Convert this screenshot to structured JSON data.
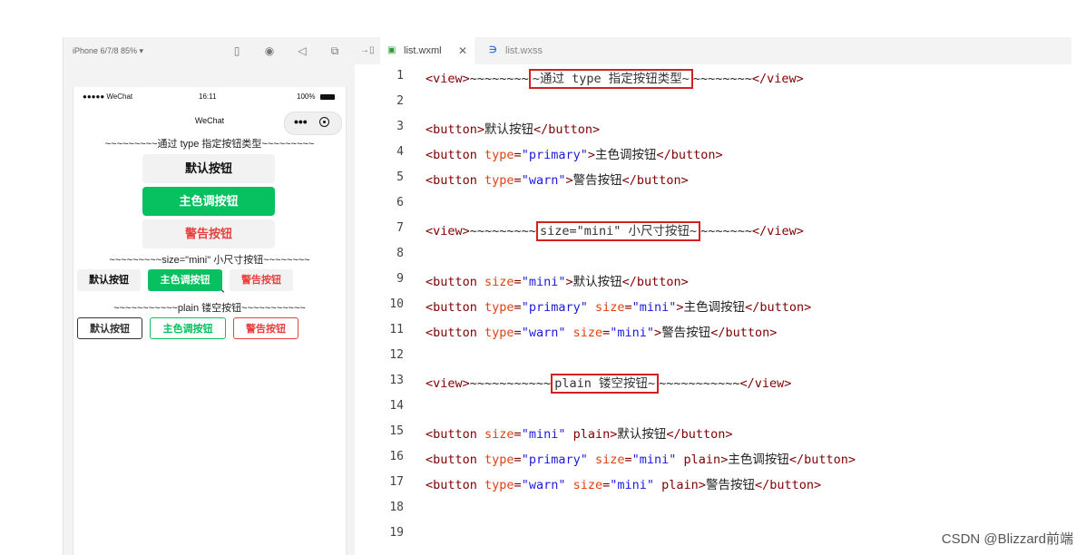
{
  "simulator": {
    "device": "iPhone 6/7/8 85% ▾",
    "statusbar": {
      "carrier": "●●●●● WeChat",
      "time": "16:11",
      "battery": "100%"
    },
    "navbar": {
      "title": "WeChat",
      "more": "•••"
    },
    "sections": [
      "~~~~~~~~~通过 type 指定按钮类型~~~~~~~~~",
      "~~~~~~~~~size=\"mini\" 小尺寸按钮~~~~~~~~",
      "~~~~~~~~~~~plain 镂空按钮~~~~~~~~~~~"
    ],
    "buttons": {
      "default": "默认按钮",
      "primary": "主色调按钮",
      "warn": "警告按钮"
    }
  },
  "editor": {
    "tabs": [
      {
        "name": "list.wxml",
        "close": "✕"
      },
      {
        "name": "list.wxss"
      }
    ],
    "lines": [
      {
        "n": "1",
        "parts": [
          [
            "tg",
            "<view>"
          ],
          [
            "tx",
            "~~~~~~~~"
          ],
          [
            "hl",
            "~通过 type 指定按钮类型~"
          ],
          [
            "tx",
            "~~~~~~~~"
          ],
          [
            "tg",
            "</view>"
          ]
        ]
      },
      {
        "n": "2",
        "parts": []
      },
      {
        "n": "3",
        "parts": [
          [
            "tg",
            "<button>"
          ],
          [
            "tx",
            "默认按钮"
          ],
          [
            "tg",
            "</button>"
          ]
        ]
      },
      {
        "n": "4",
        "parts": [
          [
            "tg",
            "<button "
          ],
          [
            "at",
            "type"
          ],
          [
            "tg",
            "="
          ],
          [
            "st",
            "\"primary\""
          ],
          [
            "tg",
            ">"
          ],
          [
            "tx",
            "主色调按钮"
          ],
          [
            "tg",
            "</button>"
          ]
        ]
      },
      {
        "n": "5",
        "parts": [
          [
            "tg",
            "<button "
          ],
          [
            "at",
            "type"
          ],
          [
            "tg",
            "="
          ],
          [
            "st",
            "\"warn\""
          ],
          [
            "tg",
            ">"
          ],
          [
            "tx",
            "警告按钮"
          ],
          [
            "tg",
            "</button>"
          ]
        ]
      },
      {
        "n": "6",
        "parts": []
      },
      {
        "n": "7",
        "parts": [
          [
            "tg",
            "<view>"
          ],
          [
            "tx",
            "~~~~~~~~~"
          ],
          [
            "hl",
            "size=\"mini\" 小尺寸按钮~"
          ],
          [
            "tx",
            "~~~~~~~"
          ],
          [
            "tg",
            "</view>"
          ]
        ]
      },
      {
        "n": "8",
        "parts": []
      },
      {
        "n": "9",
        "parts": [
          [
            "tg",
            "<button "
          ],
          [
            "at",
            "size"
          ],
          [
            "tg",
            "="
          ],
          [
            "st",
            "\"mini\""
          ],
          [
            "tg",
            ">"
          ],
          [
            "tx",
            "默认按钮"
          ],
          [
            "tg",
            "</button>"
          ]
        ]
      },
      {
        "n": "10",
        "parts": [
          [
            "tg",
            "<button "
          ],
          [
            "at",
            "type"
          ],
          [
            "tg",
            "="
          ],
          [
            "st",
            "\"primary\""
          ],
          [
            "tg",
            " "
          ],
          [
            "at",
            "size"
          ],
          [
            "tg",
            "="
          ],
          [
            "st",
            "\"mini\""
          ],
          [
            "tg",
            ">"
          ],
          [
            "tx",
            "主色调按钮"
          ],
          [
            "tg",
            "</button>"
          ]
        ]
      },
      {
        "n": "11",
        "parts": [
          [
            "tg",
            "<button "
          ],
          [
            "at",
            "type"
          ],
          [
            "tg",
            "="
          ],
          [
            "st",
            "\"warn\""
          ],
          [
            "tg",
            " "
          ],
          [
            "at",
            "size"
          ],
          [
            "tg",
            "="
          ],
          [
            "st",
            "\"mini\""
          ],
          [
            "tg",
            ">"
          ],
          [
            "tx",
            "警告按钮"
          ],
          [
            "tg",
            "</button>"
          ]
        ]
      },
      {
        "n": "12",
        "parts": []
      },
      {
        "n": "13",
        "parts": [
          [
            "tg",
            "<view>"
          ],
          [
            "tx",
            "~~~~~~~~~~~"
          ],
          [
            "hl",
            "plain 镂空按钮~"
          ],
          [
            "tx",
            "~~~~~~~~~~~"
          ],
          [
            "tg",
            "</view>"
          ]
        ]
      },
      {
        "n": "14",
        "parts": []
      },
      {
        "n": "15",
        "parts": [
          [
            "tg",
            "<button "
          ],
          [
            "at",
            "size"
          ],
          [
            "tg",
            "="
          ],
          [
            "st",
            "\"mini\""
          ],
          [
            "tg",
            " plain>"
          ],
          [
            "tx",
            "默认按钮"
          ],
          [
            "tg",
            "</button>"
          ]
        ]
      },
      {
        "n": "16",
        "parts": [
          [
            "tg",
            "<button "
          ],
          [
            "at",
            "type"
          ],
          [
            "tg",
            "="
          ],
          [
            "st",
            "\"primary\""
          ],
          [
            "tg",
            " "
          ],
          [
            "at",
            "size"
          ],
          [
            "tg",
            "="
          ],
          [
            "st",
            "\"mini\""
          ],
          [
            "tg",
            " plain>"
          ],
          [
            "tx",
            "主色调按钮"
          ],
          [
            "tg",
            "</button>"
          ]
        ]
      },
      {
        "n": "17",
        "parts": [
          [
            "tg",
            "<button "
          ],
          [
            "at",
            "type"
          ],
          [
            "tg",
            "="
          ],
          [
            "st",
            "\"warn\""
          ],
          [
            "tg",
            " "
          ],
          [
            "at",
            "size"
          ],
          [
            "tg",
            "="
          ],
          [
            "st",
            "\"mini\""
          ],
          [
            "tg",
            " plain>"
          ],
          [
            "tx",
            "警告按钮"
          ],
          [
            "tg",
            "</button>"
          ]
        ]
      },
      {
        "n": "18",
        "parts": []
      },
      {
        "n": "19",
        "parts": []
      }
    ]
  },
  "watermark": "CSDN @Blizzard前端",
  "colors": {
    "primary": "#07c160",
    "warn": "#e64340",
    "highlight_box": "#d42020"
  }
}
